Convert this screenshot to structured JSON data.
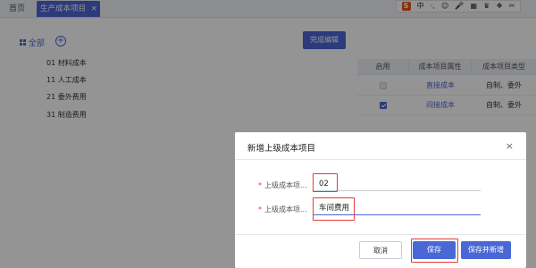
{
  "tabs": {
    "home": "首页",
    "active": "生产成本项目",
    "active_close": "×"
  },
  "ime_toolbar": {
    "logo": "S",
    "items": [
      "中",
      "·,",
      "☺",
      "🎤",
      "▦",
      "♛",
      "❖",
      "✂"
    ]
  },
  "left_panel": {
    "all_label": "全部",
    "add_icon": "+",
    "done_button": "完成编辑",
    "tree": [
      "01 材料成本",
      "11 人工成本",
      "21 委外费用",
      "31 制造费用"
    ]
  },
  "table": {
    "headers": [
      "启用",
      "成本项目属性",
      "成本项目类型"
    ],
    "rows": [
      {
        "enabled": false,
        "attr": "直接成本",
        "type": "自制、委外"
      },
      {
        "enabled": true,
        "attr": "间接成本",
        "type": "自制、委外"
      }
    ]
  },
  "dialog": {
    "title": "新增上级成本项目",
    "close": "×",
    "fields": [
      {
        "label": "上级成本项...",
        "value": "02"
      },
      {
        "label": "上级成本项...",
        "value": "车间费用"
      }
    ],
    "required_mark": "*",
    "buttons": {
      "cancel": "取消",
      "save": "保存",
      "save_new": "保存并新增"
    }
  },
  "colors": {
    "primary": "#4a67d6",
    "highlight": "#e53935",
    "overlay": "rgba(0,0,0,0.42)"
  }
}
